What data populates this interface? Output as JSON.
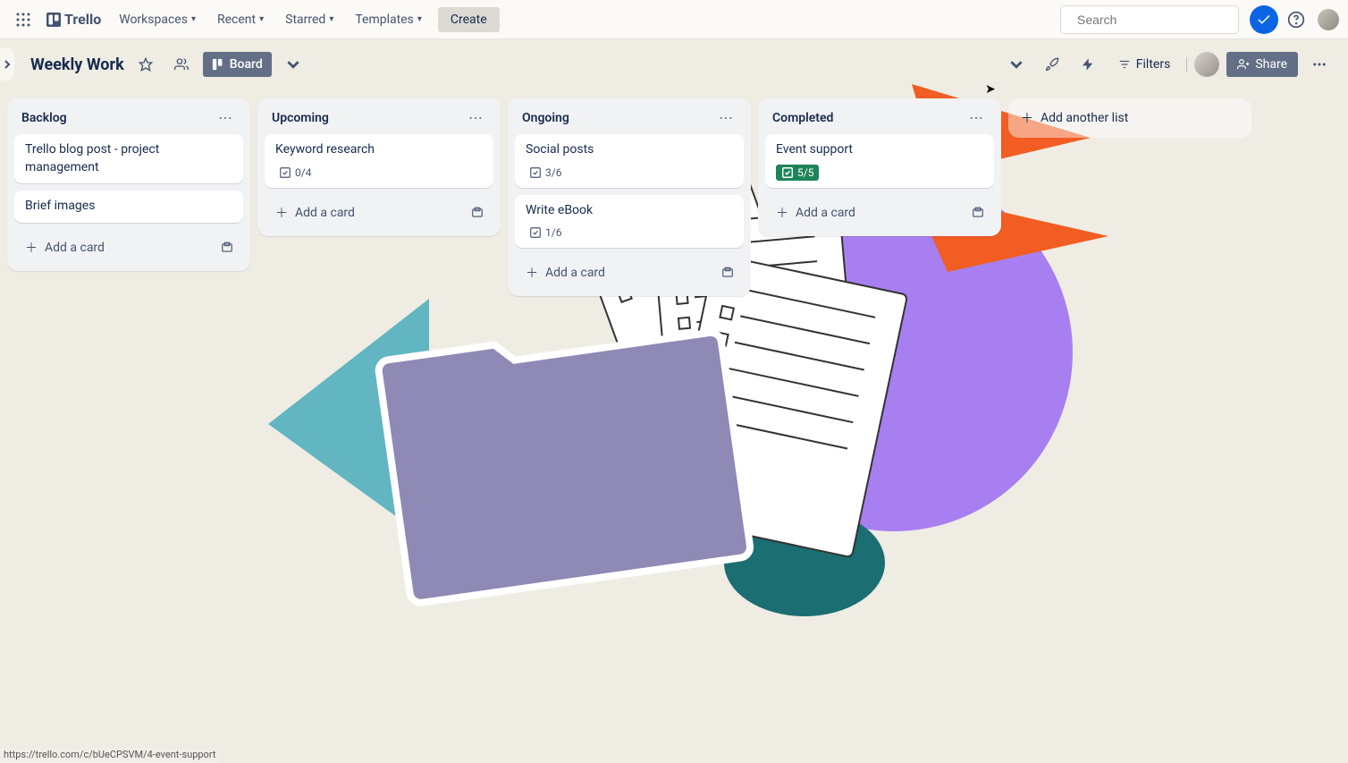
{
  "app": {
    "name": "Trello"
  },
  "nav": {
    "items": [
      "Workspaces",
      "Recent",
      "Starred",
      "Templates"
    ],
    "create": "Create",
    "search_placeholder": "Search"
  },
  "board": {
    "title": "Weekly Work",
    "view_label": "Board",
    "filters": "Filters",
    "share": "Share",
    "add_list": "Add another list"
  },
  "lists": [
    {
      "title": "Backlog",
      "cards": [
        {
          "title": "Trello blog post - project management"
        },
        {
          "title": "Brief images"
        }
      ],
      "add_card": "Add a card"
    },
    {
      "title": "Upcoming",
      "cards": [
        {
          "title": "Keyword research",
          "checklist": "0/4"
        }
      ],
      "add_card": "Add a card"
    },
    {
      "title": "Ongoing",
      "cards": [
        {
          "title": "Social posts",
          "checklist": "3/6"
        },
        {
          "title": "Write eBook",
          "checklist": "1/6"
        }
      ],
      "add_card": "Add a card"
    },
    {
      "title": "Completed",
      "cards": [
        {
          "title": "Event support",
          "checklist": "5/5",
          "done": true
        }
      ],
      "add_card": "Add a card"
    }
  ],
  "status_url": "https://trello.com/c/bUeCPSVM/4-event-support"
}
